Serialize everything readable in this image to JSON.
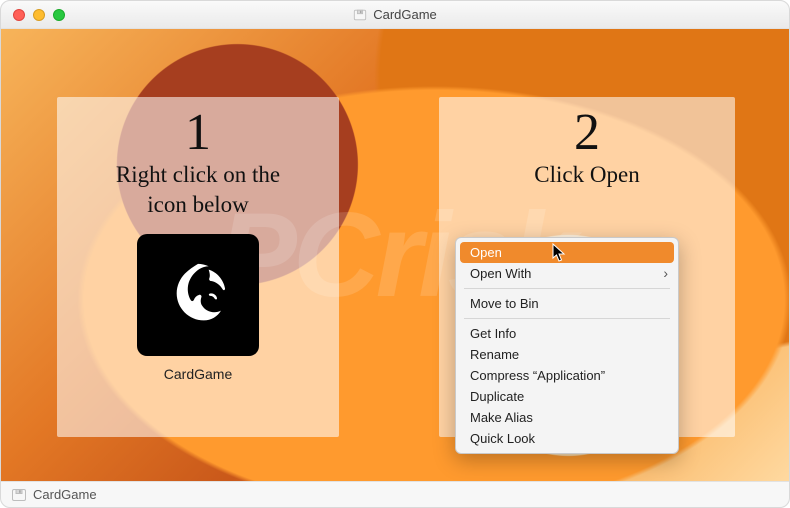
{
  "window": {
    "title": "CardGame"
  },
  "statusbar": {
    "label": "CardGame"
  },
  "step1": {
    "number": "1",
    "line1": "Right click on the",
    "line2": "icon below",
    "app_label": "CardGame"
  },
  "step2": {
    "number": "2",
    "text": "Click Open"
  },
  "context_menu": {
    "open": "Open",
    "open_with": "Open With",
    "move_to_bin": "Move to Bin",
    "get_info": "Get Info",
    "rename": "Rename",
    "compress": "Compress “Application”",
    "duplicate": "Duplicate",
    "make_alias": "Make Alias",
    "quick_look": "Quick Look"
  },
  "watermark": "PCrisk"
}
